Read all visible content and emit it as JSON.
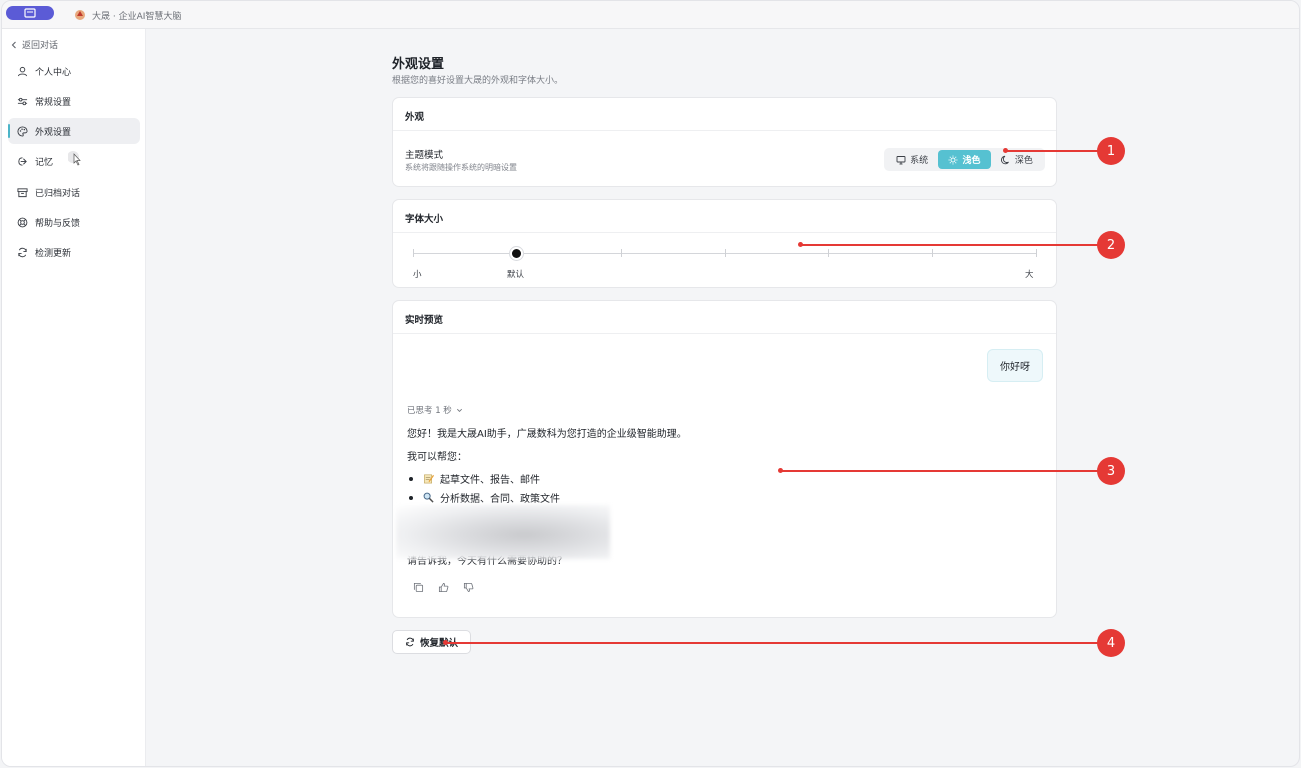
{
  "titlebar": {
    "title": "大晟 · 企业AI智慧大脑"
  },
  "sidebar": {
    "back_label": "返回对话",
    "items": [
      {
        "label": "个人中心",
        "icon": "user-icon"
      },
      {
        "label": "常规设置",
        "icon": "sliders-icon"
      },
      {
        "label": "外观设置",
        "icon": "palette-icon",
        "active": true
      },
      {
        "label": "记忆",
        "icon": "memory-icon"
      },
      {
        "label": "已归档对话",
        "icon": "archive-icon"
      },
      {
        "label": "帮助与反馈",
        "icon": "help-icon"
      },
      {
        "label": "检测更新",
        "icon": "refresh-icon"
      }
    ]
  },
  "page": {
    "title": "外观设置",
    "subtitle": "根据您的喜好设置大晟的外观和字体大小。"
  },
  "appearance": {
    "header": "外观",
    "theme_title": "主题模式",
    "theme_sub": "系统将跟随操作系统的明暗设置",
    "options": [
      "系统",
      "浅色",
      "深色"
    ],
    "selected": "浅色"
  },
  "font_size": {
    "header": "字体大小",
    "label_small": "小",
    "label_default": "默认",
    "label_large": "大",
    "steps": 7,
    "value_step": 2
  },
  "preview": {
    "header": "实时预览",
    "user_message": "你好呀",
    "thinking": "已思考 1 秒",
    "greeting": "您好！我是大晟AI助手，广晟数科为您打造的企业级智能助理。",
    "help_intro": "我可以帮您：",
    "bullets": [
      "起草文件、报告、邮件",
      "分析数据、合同、政策文件"
    ],
    "closing": "请告诉我，今天有什么需要协助的？"
  },
  "reset_label": "恢复默认",
  "callouts": [
    "1",
    "2",
    "3",
    "4"
  ],
  "colors": {
    "accent": "#56c1d1",
    "callout": "#e53935",
    "brand": "#5b5bd6"
  }
}
